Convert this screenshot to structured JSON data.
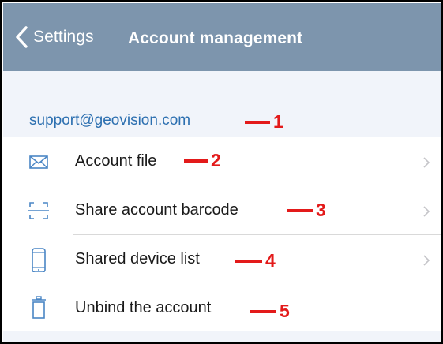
{
  "nav": {
    "back_label": "Settings",
    "title": "Account management"
  },
  "account": {
    "email": "support@geovision.com"
  },
  "menu": [
    {
      "label": "Account file",
      "icon": "envelope-icon",
      "has_chevron": true
    },
    {
      "label": "Share account barcode",
      "icon": "barcode-scan-icon",
      "has_chevron": true
    },
    {
      "label": "Shared device list",
      "icon": "phone-icon",
      "has_chevron": true
    },
    {
      "label": "Unbind the account",
      "icon": "trash-icon",
      "has_chevron": false
    }
  ],
  "annotations": [
    "1",
    "2",
    "3",
    "4",
    "5"
  ],
  "colors": {
    "header": "#7d95ad",
    "email": "#2c6fb0",
    "icon": "#4a86c5",
    "annotation": "#e31a1a",
    "band": "#f1f4fa"
  }
}
